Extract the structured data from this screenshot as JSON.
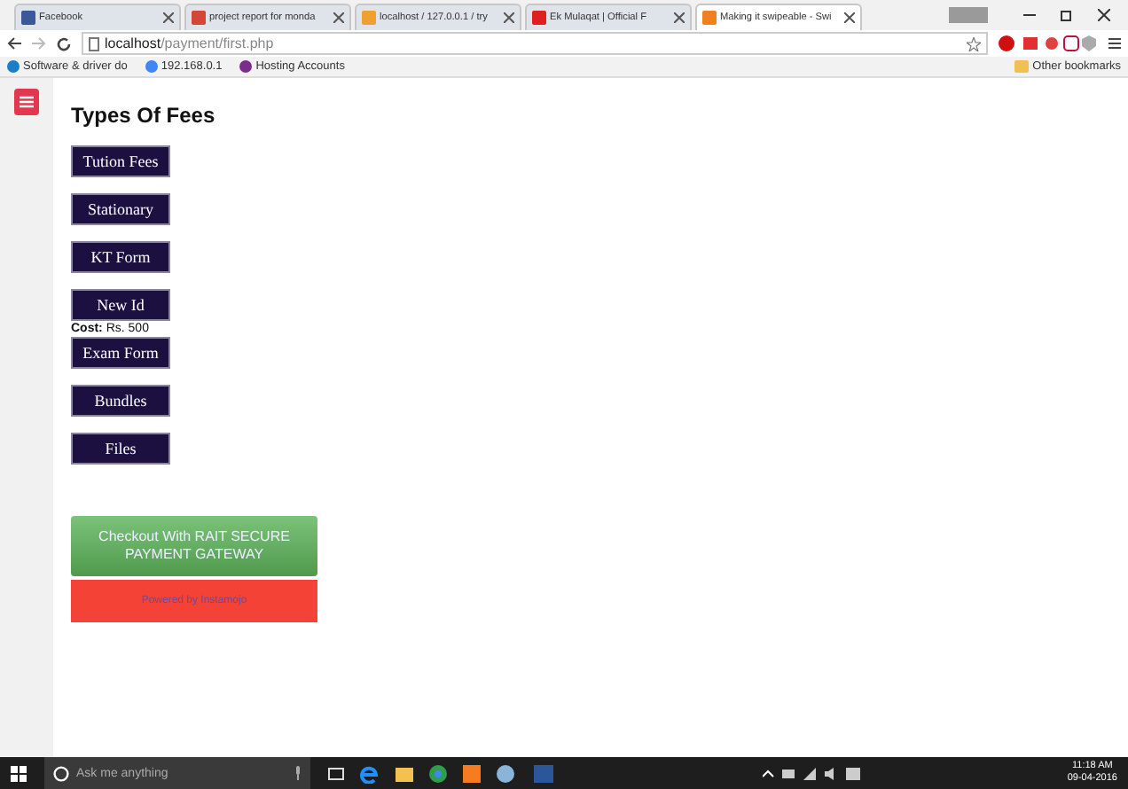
{
  "browser": {
    "tabs": [
      {
        "title": "Facebook",
        "selected": false
      },
      {
        "title": "project report for monda",
        "selected": false
      },
      {
        "title": "localhost / 127.0.0.1 / try",
        "selected": false
      },
      {
        "title": "Ek Mulaqat | Official F",
        "selected": false
      },
      {
        "title": "Making it swipeable - Swi",
        "selected": true
      }
    ],
    "address": {
      "host": "localhost",
      "path": "/payment/first.php"
    },
    "bookmarks": [
      {
        "label": "Software & driver do"
      },
      {
        "label": "192.168.0.1"
      },
      {
        "label": "Hosting Accounts"
      }
    ],
    "other_bookmarks": "Other bookmarks"
  },
  "page": {
    "heading": "Types Of Fees",
    "fees": [
      {
        "label": "Tution Fees"
      },
      {
        "label": "Stationary"
      },
      {
        "label": "KT Form"
      },
      {
        "label": "New Id",
        "detail": "**Cost:** Rs. 500"
      },
      {
        "label": "Exam Form"
      },
      {
        "label": "Bundles"
      },
      {
        "label": "Files"
      }
    ],
    "checkout": "Checkout With RAIT SECURE PAYMENT GATEWAY",
    "powered_by": "Powered by Instamojo"
  },
  "taskbar": {
    "search_placeholder": "Ask me anything",
    "time": "11:18 AM",
    "date": "09-04-2016"
  }
}
